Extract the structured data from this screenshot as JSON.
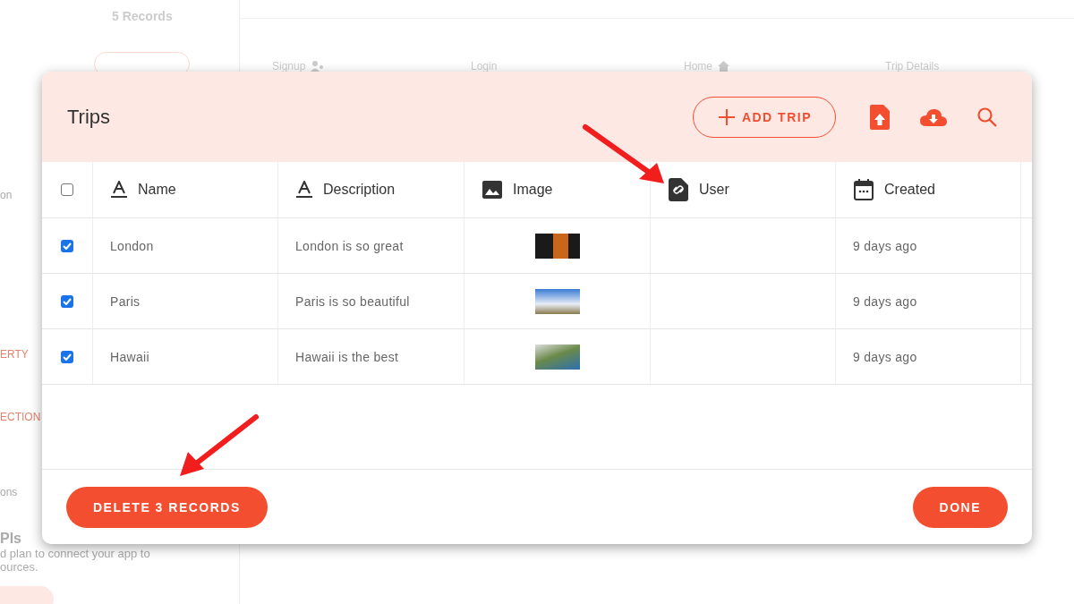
{
  "background": {
    "sidebar": {
      "records": "5 Records",
      "texts": [
        "on",
        "ERTY",
        "ECTION",
        "ons"
      ],
      "apis_title": "PIs",
      "apis_text": [
        "d plan to connect your app to",
        "ources."
      ]
    },
    "nav": [
      {
        "label": "Signup",
        "kind": "people"
      },
      {
        "label": "Login",
        "kind": "none"
      },
      {
        "label": "Home",
        "kind": "home"
      },
      {
        "label": "Trip Details",
        "kind": "none"
      }
    ]
  },
  "modal": {
    "title": "Trips",
    "add_button": "ADD TRIP",
    "columns": [
      {
        "label": "Name",
        "kind": "text"
      },
      {
        "label": "Description",
        "kind": "text"
      },
      {
        "label": "Image",
        "kind": "image"
      },
      {
        "label": "User",
        "kind": "link"
      },
      {
        "label": "Created",
        "kind": "date"
      }
    ],
    "header_checkbox": {
      "checked": false
    },
    "rows": [
      {
        "checked": true,
        "name": "London",
        "description": "London is so great",
        "created": "9 days ago"
      },
      {
        "checked": true,
        "name": "Paris",
        "description": "Paris is so beautiful",
        "created": "9 days ago"
      },
      {
        "checked": true,
        "name": "Hawaii",
        "description": "Hawaii is the best",
        "created": "9 days ago"
      }
    ],
    "delete_button": "DELETE 3 RECORDS",
    "done_button": "DONE"
  }
}
